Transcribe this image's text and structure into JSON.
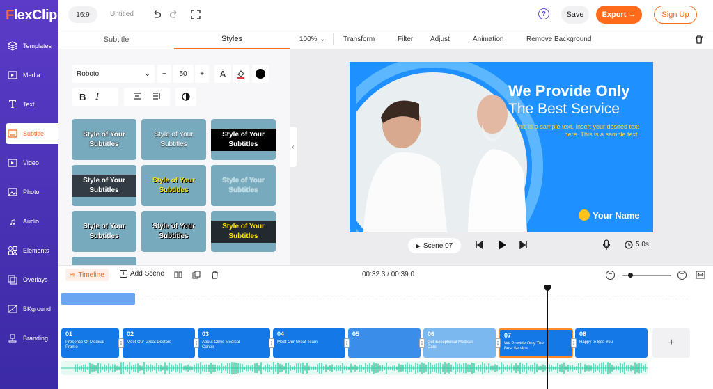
{
  "app": {
    "logo_rest": "lexClip",
    "logo_f": "F"
  },
  "sidebar": {
    "items": [
      {
        "label": "Templates",
        "icon": "layers-icon"
      },
      {
        "label": "Media",
        "icon": "media-icon"
      },
      {
        "label": "Text",
        "icon": "text-icon"
      },
      {
        "label": "Subtitle",
        "icon": "subtitle-icon"
      },
      {
        "label": "Video",
        "icon": "video-icon"
      },
      {
        "label": "Photo",
        "icon": "photo-icon"
      },
      {
        "label": "Audio",
        "icon": "audio-icon"
      },
      {
        "label": "Elements",
        "icon": "elements-icon"
      },
      {
        "label": "Overlays",
        "icon": "overlays-icon"
      },
      {
        "label": "BKground",
        "icon": "background-icon"
      },
      {
        "label": "Branding",
        "icon": "branding-icon"
      }
    ],
    "active": "Subtitle"
  },
  "topbar": {
    "ratio": "16:9",
    "title": "Untitled",
    "save": "Save",
    "export": "Export →",
    "signup": "Sign Up",
    "help": "?"
  },
  "panel": {
    "tabs": [
      "Subtitle",
      "Styles"
    ],
    "active_tab": "Styles",
    "font": "Roboto",
    "font_size": "50",
    "minus": "−",
    "plus": "+",
    "text_color_glyph": "A",
    "bold": "B",
    "italic": "I",
    "tiles": [
      "Style of Your Subtitles",
      "Style of Your Subtitles",
      "Style of Your Subtitles",
      "Style of Your Subtitles",
      "Style of Your Subtitles",
      "Style of Your Subtitles",
      "Style of Your Subtitles",
      "Style of Your Subtitles",
      "Style of Your Subtitles"
    ]
  },
  "toolbar": {
    "zoom": "100%",
    "items": [
      "Transform",
      "Filter",
      "Adjust",
      "Animation",
      "Remove Background"
    ]
  },
  "canvas": {
    "heading1": "We Provide Only",
    "heading2": "The Best Service",
    "body": "This is a sample text. Insert your desired text here. This is a sample text.",
    "name": "Your Name"
  },
  "player": {
    "scene_label": "Scene 07",
    "duration": "5.0s"
  },
  "timeline": {
    "label": "Timeline",
    "add_scene": "Add Scene",
    "time": "00:32.3 / 00:39.0",
    "add": "+"
  },
  "scenes": [
    {
      "num": "01",
      "text": "Presence Of Medical Promo"
    },
    {
      "num": "02",
      "text": "Meet Our Great Doctors"
    },
    {
      "num": "03",
      "text": "About Clinic Medical Center"
    },
    {
      "num": "04",
      "text": "Meet Our Great Team"
    },
    {
      "num": "05",
      "text": ""
    },
    {
      "num": "06",
      "text": "Get Exceptional Medical Care"
    },
    {
      "num": "07",
      "text": "We Provide Only The Best Service"
    },
    {
      "num": "08",
      "text": "Happy to See You"
    }
  ],
  "colors": {
    "accent": "#ff6b1a",
    "sidebar": "#4a33b8",
    "canvas_bg": "#1e90ff",
    "waveform": "#2fd3a8"
  }
}
